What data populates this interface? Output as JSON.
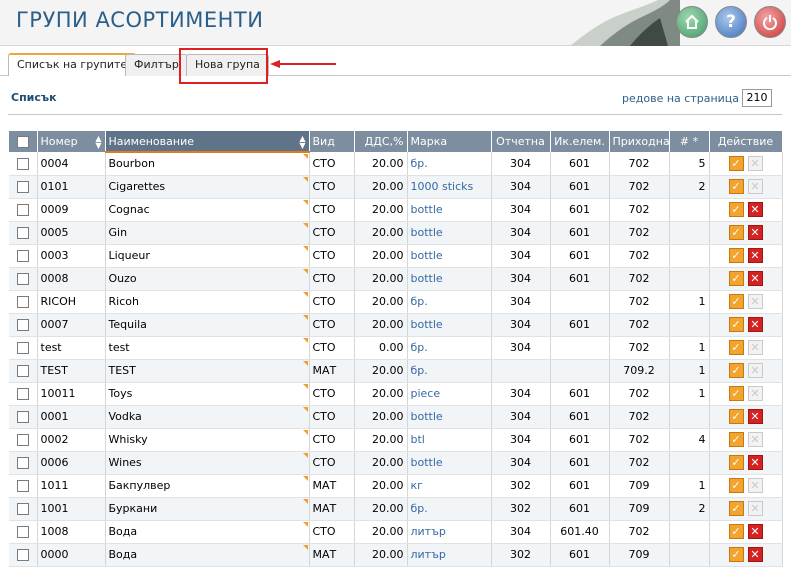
{
  "header": {
    "title": "ГРУПИ АСОРТИМЕНТИ"
  },
  "tabs": [
    {
      "label": "Списък на групите"
    },
    {
      "label": "Филтър"
    },
    {
      "label": "Нова група"
    }
  ],
  "list_label": "Списък",
  "per_page": {
    "label": "редове на страница »",
    "value": "210"
  },
  "columns": [
    "Номер",
    "Наименование",
    "Вид",
    "ДДС,%",
    "Марка",
    "Отчетна",
    "Ик.елем.",
    "Приходна",
    "# *",
    "Действие"
  ],
  "rows": [
    {
      "num": "0004",
      "name": "Bourbon",
      "type": "СТО",
      "vat": "20.00",
      "brand": "бр.",
      "acc": "304",
      "elem": "601",
      "inc": "702",
      "count": "5",
      "deletable": false
    },
    {
      "num": "0101",
      "name": "Cigarettes",
      "type": "СТО",
      "vat": "20.00",
      "brand": "1000 sticks",
      "acc": "304",
      "elem": "601",
      "inc": "702",
      "count": "2",
      "deletable": false
    },
    {
      "num": "0009",
      "name": "Cognac",
      "type": "СТО",
      "vat": "20.00",
      "brand": "bottle",
      "acc": "304",
      "elem": "601",
      "inc": "702",
      "count": "",
      "deletable": true
    },
    {
      "num": "0005",
      "name": "Gin",
      "type": "СТО",
      "vat": "20.00",
      "brand": "bottle",
      "acc": "304",
      "elem": "601",
      "inc": "702",
      "count": "",
      "deletable": true
    },
    {
      "num": "0003",
      "name": "Liqueur",
      "type": "СТО",
      "vat": "20.00",
      "brand": "bottle",
      "acc": "304",
      "elem": "601",
      "inc": "702",
      "count": "",
      "deletable": true
    },
    {
      "num": "0008",
      "name": "Ouzo",
      "type": "СТО",
      "vat": "20.00",
      "brand": "bottle",
      "acc": "304",
      "elem": "601",
      "inc": "702",
      "count": "",
      "deletable": true
    },
    {
      "num": "RICOH",
      "name": "Ricoh",
      "type": "СТО",
      "vat": "20.00",
      "brand": "бр.",
      "acc": "304",
      "elem": "",
      "inc": "702",
      "count": "1",
      "deletable": false
    },
    {
      "num": "0007",
      "name": "Tequila",
      "type": "СТО",
      "vat": "20.00",
      "brand": "bottle",
      "acc": "304",
      "elem": "601",
      "inc": "702",
      "count": "",
      "deletable": true
    },
    {
      "num": "test",
      "name": "test",
      "type": "СТО",
      "vat": "0.00",
      "brand": "бр.",
      "acc": "304",
      "elem": "",
      "inc": "702",
      "count": "1",
      "deletable": false
    },
    {
      "num": "TEST",
      "name": "TEST",
      "type": "МАТ",
      "vat": "20.00",
      "brand": "бр.",
      "acc": "",
      "elem": "",
      "inc": "709.2",
      "count": "1",
      "deletable": false
    },
    {
      "num": "10011",
      "name": "Toys",
      "type": "СТО",
      "vat": "20.00",
      "brand": "piece",
      "acc": "304",
      "elem": "601",
      "inc": "702",
      "count": "1",
      "deletable": false
    },
    {
      "num": "0001",
      "name": "Vodka",
      "type": "СТО",
      "vat": "20.00",
      "brand": "bottle",
      "acc": "304",
      "elem": "601",
      "inc": "702",
      "count": "",
      "deletable": true
    },
    {
      "num": "0002",
      "name": "Whisky",
      "type": "СТО",
      "vat": "20.00",
      "brand": "btl",
      "acc": "304",
      "elem": "601",
      "inc": "702",
      "count": "4",
      "deletable": false
    },
    {
      "num": "0006",
      "name": "Wines",
      "type": "СТО",
      "vat": "20.00",
      "brand": "bottle",
      "acc": "304",
      "elem": "601",
      "inc": "702",
      "count": "",
      "deletable": true
    },
    {
      "num": "1011",
      "name": "Бакпулвер",
      "type": "МАТ",
      "vat": "20.00",
      "brand": "кг",
      "acc": "302",
      "elem": "601",
      "inc": "709",
      "count": "1",
      "deletable": false
    },
    {
      "num": "1001",
      "name": "Буркани",
      "type": "МАТ",
      "vat": "20.00",
      "brand": "бр.",
      "acc": "302",
      "elem": "601",
      "inc": "709",
      "count": "2",
      "deletable": false
    },
    {
      "num": "1008",
      "name": "Вода",
      "type": "СТО",
      "vat": "20.00",
      "brand": "литър",
      "acc": "304",
      "elem": "601.40",
      "inc": "702",
      "count": "",
      "deletable": true
    },
    {
      "num": "0000",
      "name": "Вода",
      "type": "МАТ",
      "vat": "20.00",
      "brand": "литър",
      "acc": "302",
      "elem": "601",
      "inc": "709",
      "count": "",
      "deletable": true
    }
  ],
  "colors": {
    "title": "#2a5f8a",
    "header_bg": "#7d8ea0",
    "sort_accent": "#e07a22",
    "edit": "#f3a42f",
    "delete": "#d32222"
  },
  "icons": [
    "home-icon",
    "help-icon",
    "power-icon",
    "edit-icon",
    "delete-icon"
  ]
}
